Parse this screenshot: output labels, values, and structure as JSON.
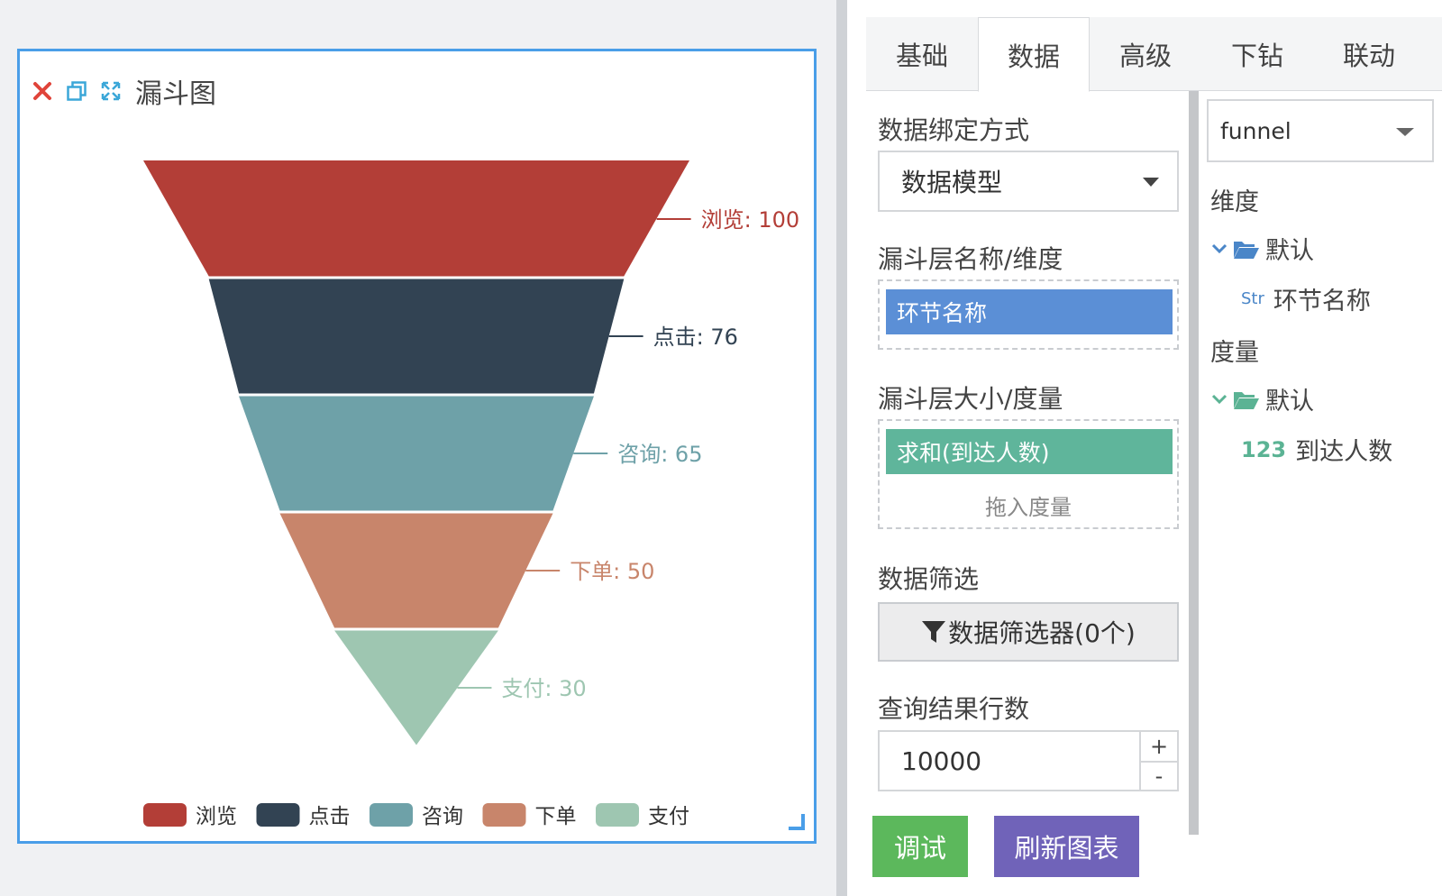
{
  "card": {
    "title": "漏斗图",
    "icons": {
      "close": "close-icon",
      "copy": "copy-icon",
      "fullscreen": "fullscreen-icon"
    }
  },
  "chart_data": {
    "type": "funnel",
    "categories": [
      "浏览",
      "点击",
      "咨询",
      "下单",
      "支付"
    ],
    "values": [
      100,
      76,
      65,
      50,
      30
    ],
    "colors": [
      "#b33e37",
      "#324353",
      "#6ea1a8",
      "#c8856b",
      "#9ec6b1"
    ],
    "label_separator": ": ",
    "legend_position": "bottom"
  },
  "tabs": [
    {
      "label": "基础",
      "active": false
    },
    {
      "label": "数据",
      "active": true
    },
    {
      "label": "高级",
      "active": false
    },
    {
      "label": "下钻",
      "active": false
    },
    {
      "label": "联动",
      "active": false
    }
  ],
  "config": {
    "binding_label": "数据绑定方式",
    "binding_value": "数据模型",
    "dimension_label": "漏斗层名称/维度",
    "dimension_chip": "环节名称",
    "measure_label": "漏斗层大小/度量",
    "measure_chip": "求和(到达人数)",
    "measure_hint": "拖入度量",
    "filter_label": "数据筛选",
    "filter_button": "数据筛选器(0个)",
    "rows_label": "查询结果行数",
    "rows_value": "10000",
    "step_up": "+",
    "step_down": "-",
    "debug_button": "调试",
    "refresh_button": "刷新图表",
    "colors": {
      "dimension_chip": "#5b8fd6",
      "measure_chip": "#5fb59b",
      "debug": "#5cb85c",
      "refresh": "#7063b9"
    }
  },
  "fields": {
    "model": "funnel",
    "dimension_head": "维度",
    "dimension_folder": "默认",
    "dimension_type": "Str",
    "dimension_field": "环节名称",
    "measure_head": "度量",
    "measure_folder": "默认",
    "measure_type": "123",
    "measure_field": "到达人数"
  }
}
